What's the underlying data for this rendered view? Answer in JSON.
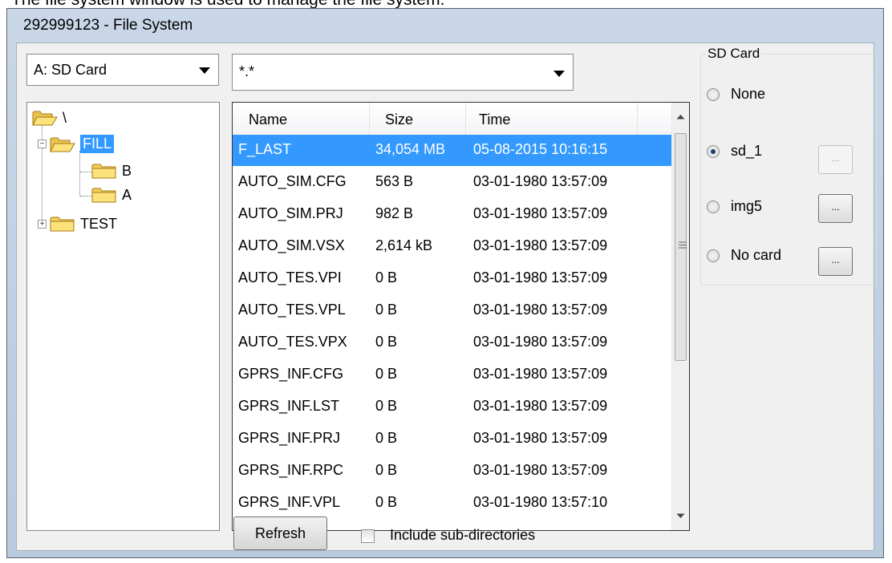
{
  "caption": "The file system window is used to manage the file system.",
  "window": {
    "title": "292999123 - File System"
  },
  "drive": {
    "selected": "A: SD Card"
  },
  "filter": {
    "value": "*.*"
  },
  "tree": {
    "root": "\\",
    "items": [
      {
        "label": "FILL",
        "selected": true,
        "expander": "−"
      },
      {
        "label": "B"
      },
      {
        "label": "A"
      },
      {
        "label": "TEST",
        "expander": "+"
      }
    ]
  },
  "files": {
    "columns": [
      "Name",
      "Size",
      "Time"
    ],
    "rows": [
      {
        "name": "F_LAST",
        "size": "34,054 MB",
        "time": "05-08-2015 10:16:15",
        "selected": true
      },
      {
        "name": "AUTO_SIM.CFG",
        "size": "563 B",
        "time": "03-01-1980 13:57:09"
      },
      {
        "name": "AUTO_SIM.PRJ",
        "size": "982 B",
        "time": "03-01-1980 13:57:09"
      },
      {
        "name": "AUTO_SIM.VSX",
        "size": "2,614 kB",
        "time": "03-01-1980 13:57:09"
      },
      {
        "name": "AUTO_TES.VPI",
        "size": "0 B",
        "time": "03-01-1980 13:57:09"
      },
      {
        "name": "AUTO_TES.VPL",
        "size": "0 B",
        "time": "03-01-1980 13:57:09"
      },
      {
        "name": "AUTO_TES.VPX",
        "size": "0 B",
        "time": "03-01-1980 13:57:09"
      },
      {
        "name": "GPRS_INF.CFG",
        "size": "0 B",
        "time": "03-01-1980 13:57:09"
      },
      {
        "name": "GPRS_INF.LST",
        "size": "0 B",
        "time": "03-01-1980 13:57:09"
      },
      {
        "name": "GPRS_INF.PRJ",
        "size": "0 B",
        "time": "03-01-1980 13:57:09"
      },
      {
        "name": "GPRS_INF.RPC",
        "size": "0 B",
        "time": "03-01-1980 13:57:09"
      },
      {
        "name": "GPRS_INF.VPL",
        "size": "0 B",
        "time": "03-01-1980 13:57:10"
      }
    ]
  },
  "sdcard": {
    "legend": "SD Card",
    "options": [
      {
        "label": "None",
        "checked": false
      },
      {
        "label": "sd_1",
        "checked": true,
        "button": "...",
        "button_enabled": false
      },
      {
        "label": "img5",
        "checked": false,
        "button": "...",
        "button_enabled": true
      },
      {
        "label": "No card",
        "checked": false,
        "button": "...",
        "button_enabled": true
      }
    ]
  },
  "footer": {
    "refresh_label": "Refresh",
    "include_subdirs_label": "Include sub-directories",
    "include_subdirs_checked": false
  },
  "colors": {
    "selection": "#3399ff",
    "title_gradient": "#c9d7e8",
    "client_bg": "#f0f0f0"
  }
}
